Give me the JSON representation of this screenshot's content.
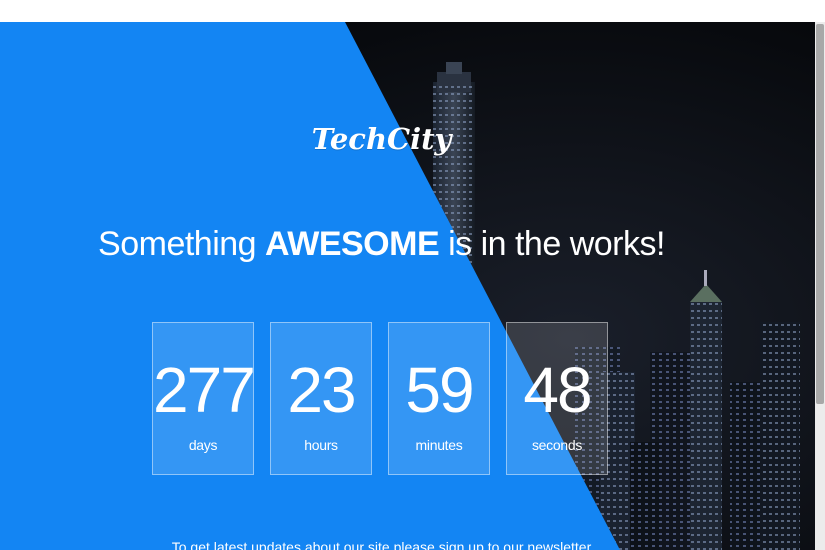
{
  "logo": "TechCity",
  "headline": {
    "before": "Something ",
    "strong": "AWESOME",
    "after": " is in the works!"
  },
  "countdown": [
    {
      "value": "277",
      "unit": "days"
    },
    {
      "value": "23",
      "unit": "hours"
    },
    {
      "value": "59",
      "unit": "minutes"
    },
    {
      "value": "48",
      "unit": "seconds"
    }
  ],
  "newsletter_text": "To get latest updates about our site please sign up to our newsletter",
  "colors": {
    "accent_blue": "#1385f3",
    "background_dark": "#050608"
  }
}
